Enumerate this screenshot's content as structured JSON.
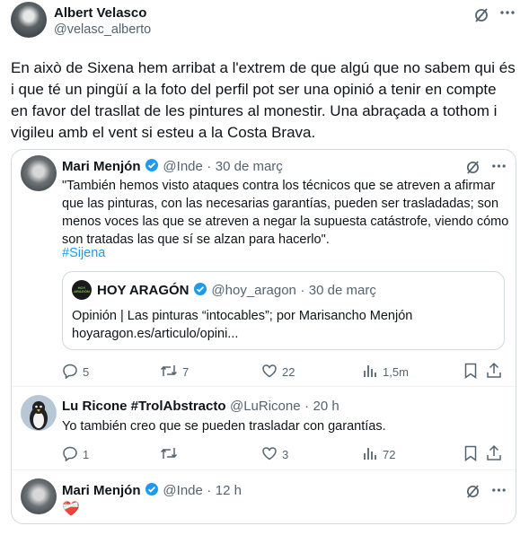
{
  "author": {
    "name": "Albert Velasco",
    "handle": "@velasc_alberto"
  },
  "post": {
    "text": "En això de Sixena hem arribat a l'extrem de que algú que no sabem qui és i que té un pingüí a la foto del perfil pot ser una opinió a tenir en compte en favor del trasllat de les pintures al monestir. Una abraçada a tothom i vigileu amb el vent si esteu a la Costa Brava."
  },
  "quoted": {
    "name": "Mari Menjón",
    "handle": "@Inde",
    "time": "30 de març",
    "text": "\"También hemos visto ataques contra los técnicos que se atreven a afirmar que las pinturas, con las necesarias garantías, pueden ser trasladadas; son menos voces las que se atreven a negar la supuesta catástrofe, viendo cómo son tratadas las que sí se alzan para hacerlo\".",
    "hashtag": "#Sijena",
    "nested": {
      "logo_text": "HOY ARAGÓN",
      "name": "HOY ARAGÓN",
      "handle": "@hoy_aragon",
      "time": "30 de març",
      "line1": "Opinión | Las pinturas “intocables”; por Marisancho Menjón",
      "line2": "hoyaragon.es/articulo/opini..."
    },
    "stats": {
      "replies": "5",
      "retweets": "7",
      "likes": "22",
      "views": "1,5m"
    },
    "replies": [
      {
        "name": "Lu Ricone #TrolAbstracto",
        "handle": "@LuRicone",
        "time": "20 h",
        "text": "Yo también creo que se pueden trasladar con garantías.",
        "stats": {
          "replies": "1",
          "retweets": "",
          "likes": "3",
          "views": "72"
        }
      },
      {
        "name": "Mari Menjón",
        "handle": "@Inde",
        "time": "12 h",
        "text": "❤️‍🩹"
      }
    ]
  },
  "colors": {
    "accent": "#1d9bf0",
    "muted": "#536471",
    "border": "#cfd9de",
    "text": "#0f1419"
  },
  "icons": [
    "grok-icon",
    "more-icon",
    "verified-icon",
    "reply-icon",
    "retweet-icon",
    "like-icon",
    "views-icon",
    "bookmark-icon",
    "share-icon"
  ]
}
